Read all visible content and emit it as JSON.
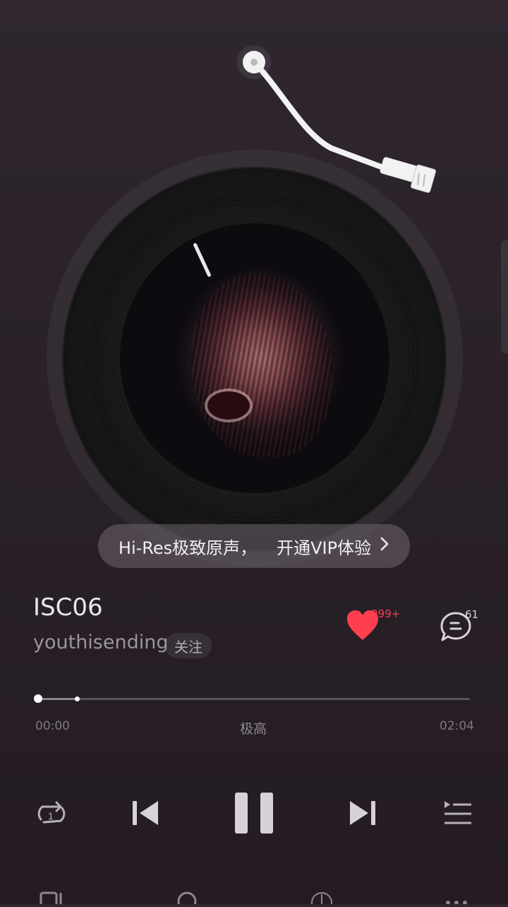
{
  "banner": {
    "left": "Hi-Res极致原声，",
    "right": "开通VIP体验"
  },
  "song": {
    "title": "ISC06",
    "artist": "youthisending",
    "follow_label": "关注"
  },
  "actions": {
    "like_count": "999+",
    "comment_count": "61"
  },
  "progress": {
    "elapsed": "00:00",
    "duration": "02:04",
    "quality": "极高",
    "played_fraction": 0.0,
    "buffered_fraction": 0.09
  },
  "icons": {
    "repeat": "repeat-one-icon",
    "prev": "skip-previous-icon",
    "pause": "pause-icon",
    "next": "skip-next-icon",
    "playlist": "playlist-icon",
    "like": "heart-icon",
    "comment": "comment-icon",
    "chevron": "chevron-right-icon"
  },
  "colors": {
    "accent": "#ff3f4f",
    "background": "#2a2129"
  }
}
